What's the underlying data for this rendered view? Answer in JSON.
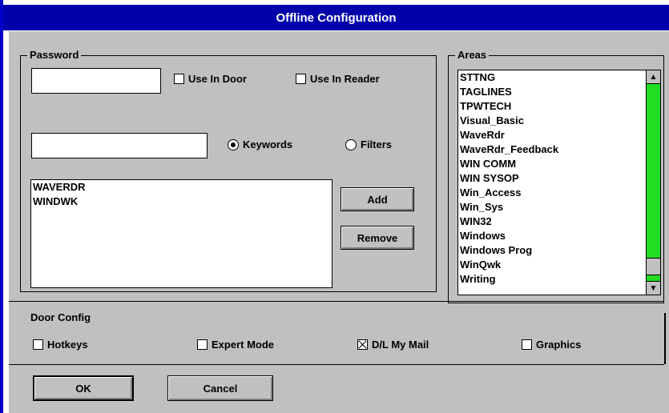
{
  "window": {
    "title": "Offline Configuration"
  },
  "password": {
    "legend": "Password",
    "value": "",
    "use_in_door": {
      "label": "Use In Door",
      "checked": false
    },
    "use_in_reader": {
      "label": "Use In Reader",
      "checked": false
    },
    "keyword_input": "",
    "keywords_radio": {
      "label": "Keywords",
      "selected": true
    },
    "filters_radio": {
      "label": "Filters",
      "selected": false
    },
    "list": [
      "WAVERDR",
      "WINDWK"
    ],
    "add_label": "Add",
    "remove_label": "Remove"
  },
  "areas": {
    "legend": "Areas",
    "items": [
      "STTNG",
      "TAGLINES",
      "TPWTECH",
      "Visual_Basic",
      "WaveRdr",
      "WaveRdr_Feedback",
      "WIN COMM",
      "WIN SYSOP",
      "Win_Access",
      "Win_Sys",
      "WIN32",
      "Windows",
      "Windows Prog",
      "WinQwk",
      "Writing"
    ],
    "scroll_color": "#22dd22"
  },
  "door": {
    "title": "Door Config",
    "hotkeys": {
      "label": "Hotkeys",
      "checked": false
    },
    "expert_mode": {
      "label": "Expert Mode",
      "checked": false
    },
    "dl_my_mail": {
      "label": "D/L My Mail",
      "checked": true
    },
    "graphics": {
      "label": "Graphics",
      "checked": false
    }
  },
  "buttons": {
    "ok": "OK",
    "cancel": "Cancel"
  }
}
